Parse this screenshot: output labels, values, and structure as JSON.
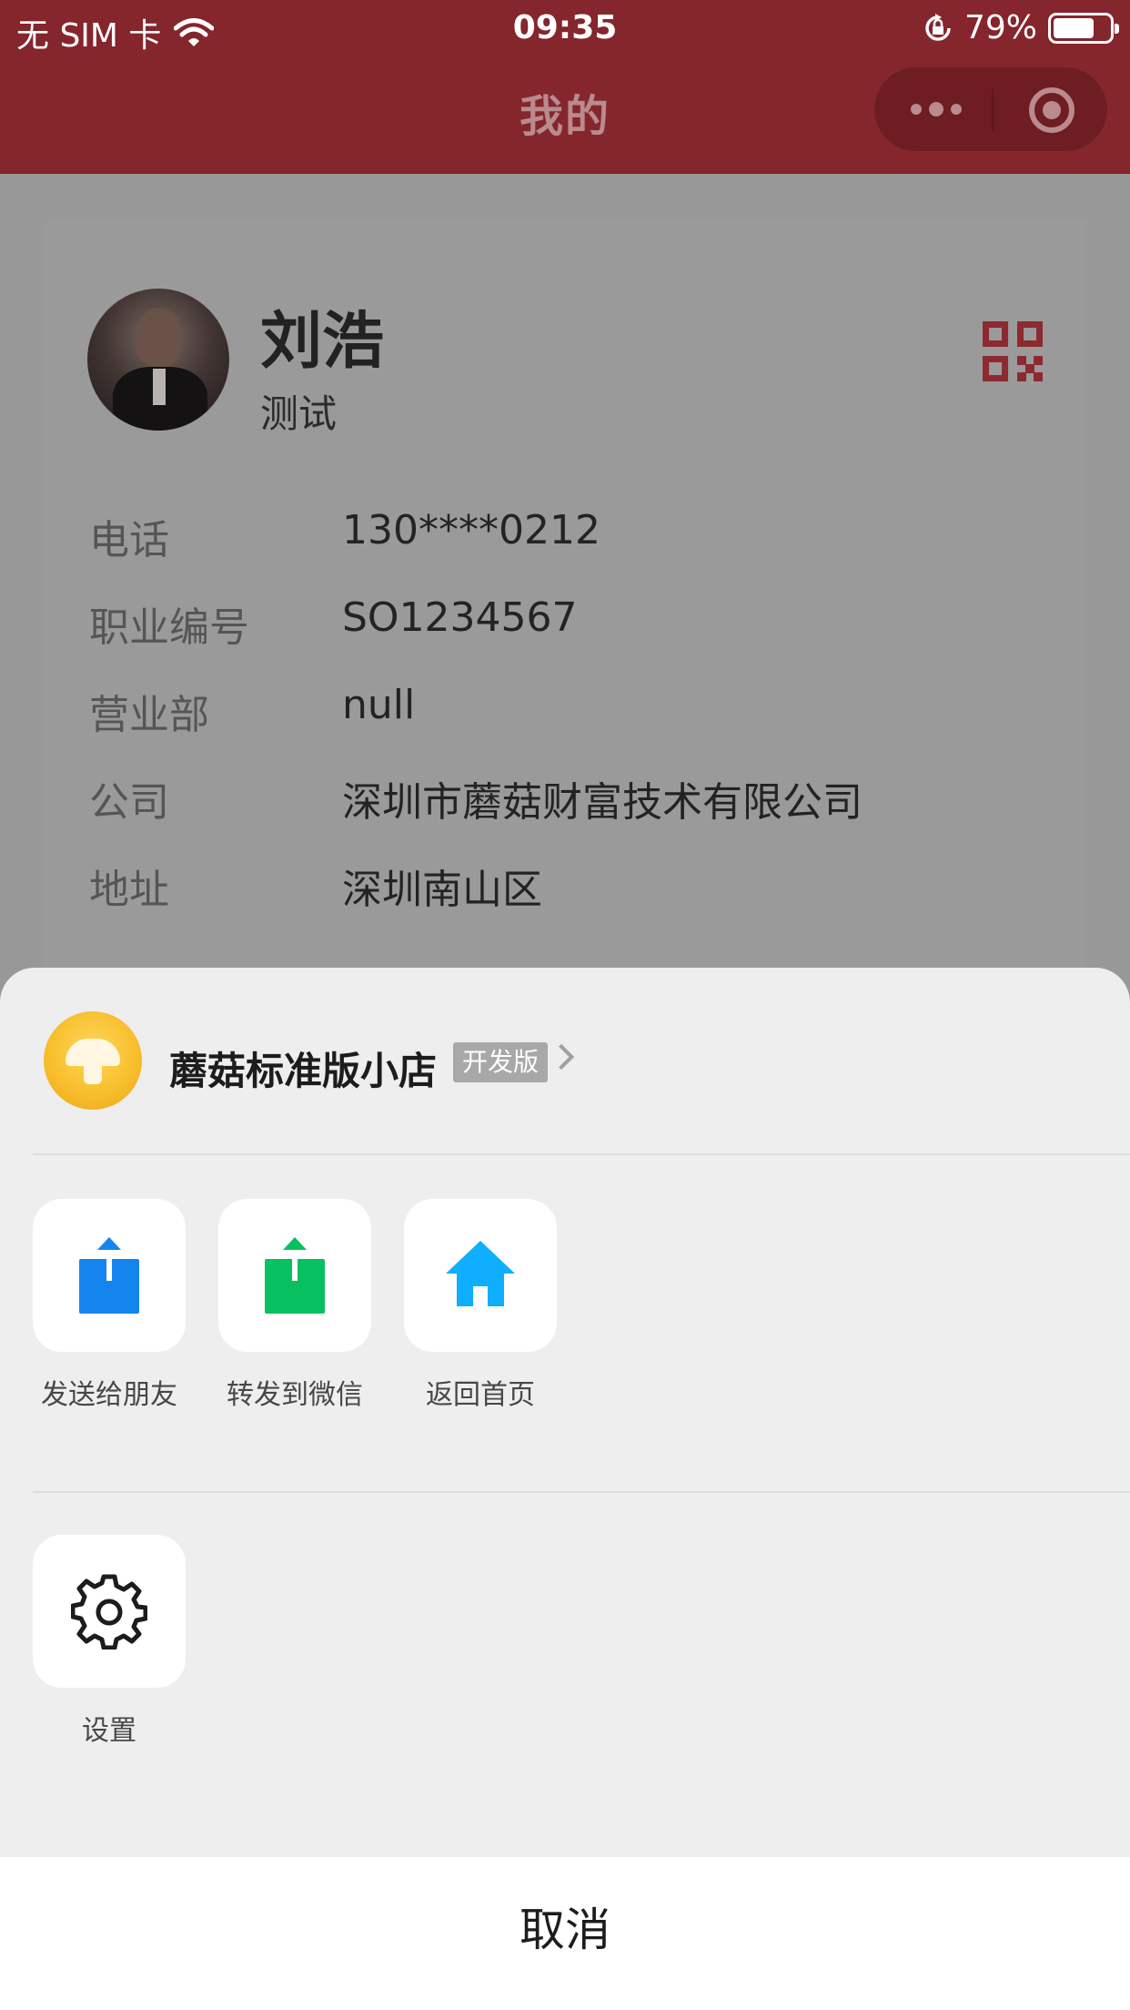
{
  "status_bar": {
    "carrier": "无 SIM 卡",
    "time": "09:35",
    "battery": "79%",
    "battery_level": 0.79
  },
  "nav": {
    "title": "我的"
  },
  "profile": {
    "name": "刘浩",
    "subtitle": "测试",
    "fields": [
      {
        "label": "电话",
        "value": "130****0212"
      },
      {
        "label": "职业编号",
        "value": "SO1234567"
      },
      {
        "label": "营业部",
        "value": "null"
      },
      {
        "label": "公司",
        "value": "深圳市蘑菇财富技术有限公司"
      },
      {
        "label": "地址",
        "value": "深圳南山区"
      }
    ]
  },
  "sheet": {
    "mini_program": {
      "name": "蘑菇标准版小店",
      "badge": "开发版"
    },
    "actions": [
      {
        "label": "发送给朋友",
        "icon": "share-friend-icon",
        "color": "#1485ee"
      },
      {
        "label": "转发到微信",
        "icon": "share-wechat-icon",
        "color": "#07c160"
      },
      {
        "label": "返回首页",
        "icon": "home-icon",
        "color": "#10aeff"
      }
    ],
    "settings": {
      "label": "设置",
      "icon": "gear-icon"
    },
    "cancel": "取消"
  },
  "colors": {
    "nav_bg": "#85252c",
    "qr": "#8c2a30"
  }
}
